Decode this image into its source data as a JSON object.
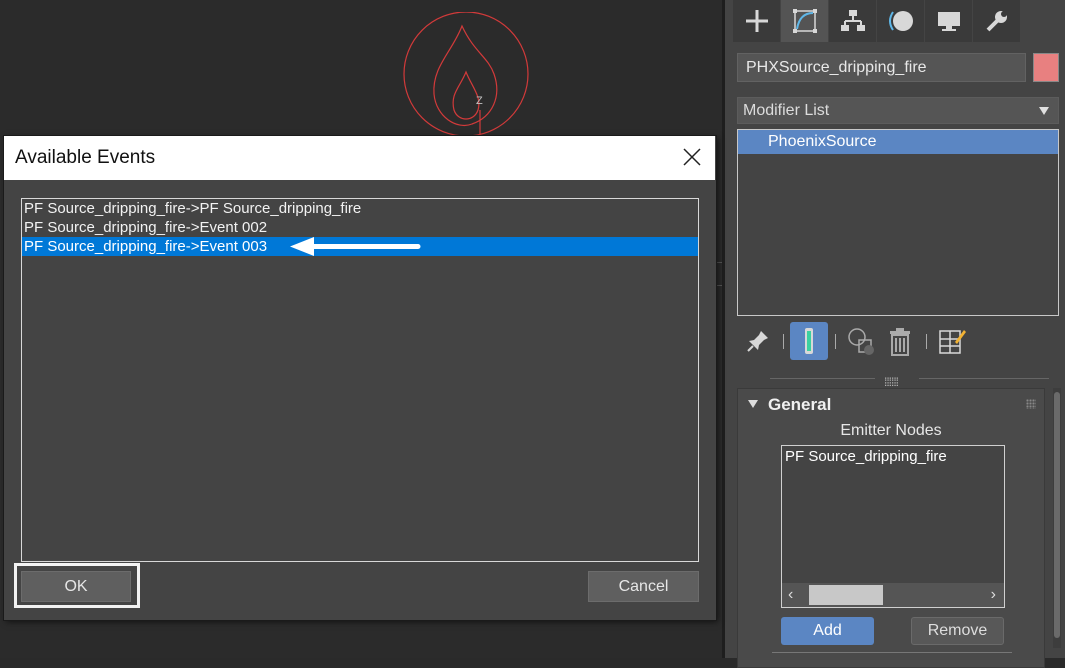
{
  "dialog": {
    "title": "Available Events",
    "events": [
      "PF Source_dripping_fire->PF Source_dripping_fire",
      "PF Source_dripping_fire->Event 002",
      "PF Source_dripping_fire->Event 003"
    ],
    "selected_index": 2,
    "ok_label": "OK",
    "cancel_label": "Cancel"
  },
  "viewport": {
    "gizmo_axis": "Z"
  },
  "command_panel": {
    "tabs": [
      "create-icon",
      "modify-icon",
      "hierarchy-icon",
      "motion-icon",
      "display-icon",
      "utilities-icon"
    ],
    "active_tab": "modify-icon",
    "object_name": "PHXSource_dripping_fire",
    "object_color": "#e88080",
    "modifier_list_label": "Modifier List",
    "stack_items": [
      "PhoenixSource"
    ],
    "rollout": {
      "title": "General",
      "emitter_nodes_label": "Emitter Nodes",
      "emitter_nodes": [
        "PF Source_dripping_fire"
      ],
      "add_label": "Add",
      "remove_label": "Remove"
    }
  },
  "colors": {
    "selection_blue": "#0078d7",
    "panel_accent": "#5b86c3",
    "gizmo_red": "#d23a3a"
  }
}
